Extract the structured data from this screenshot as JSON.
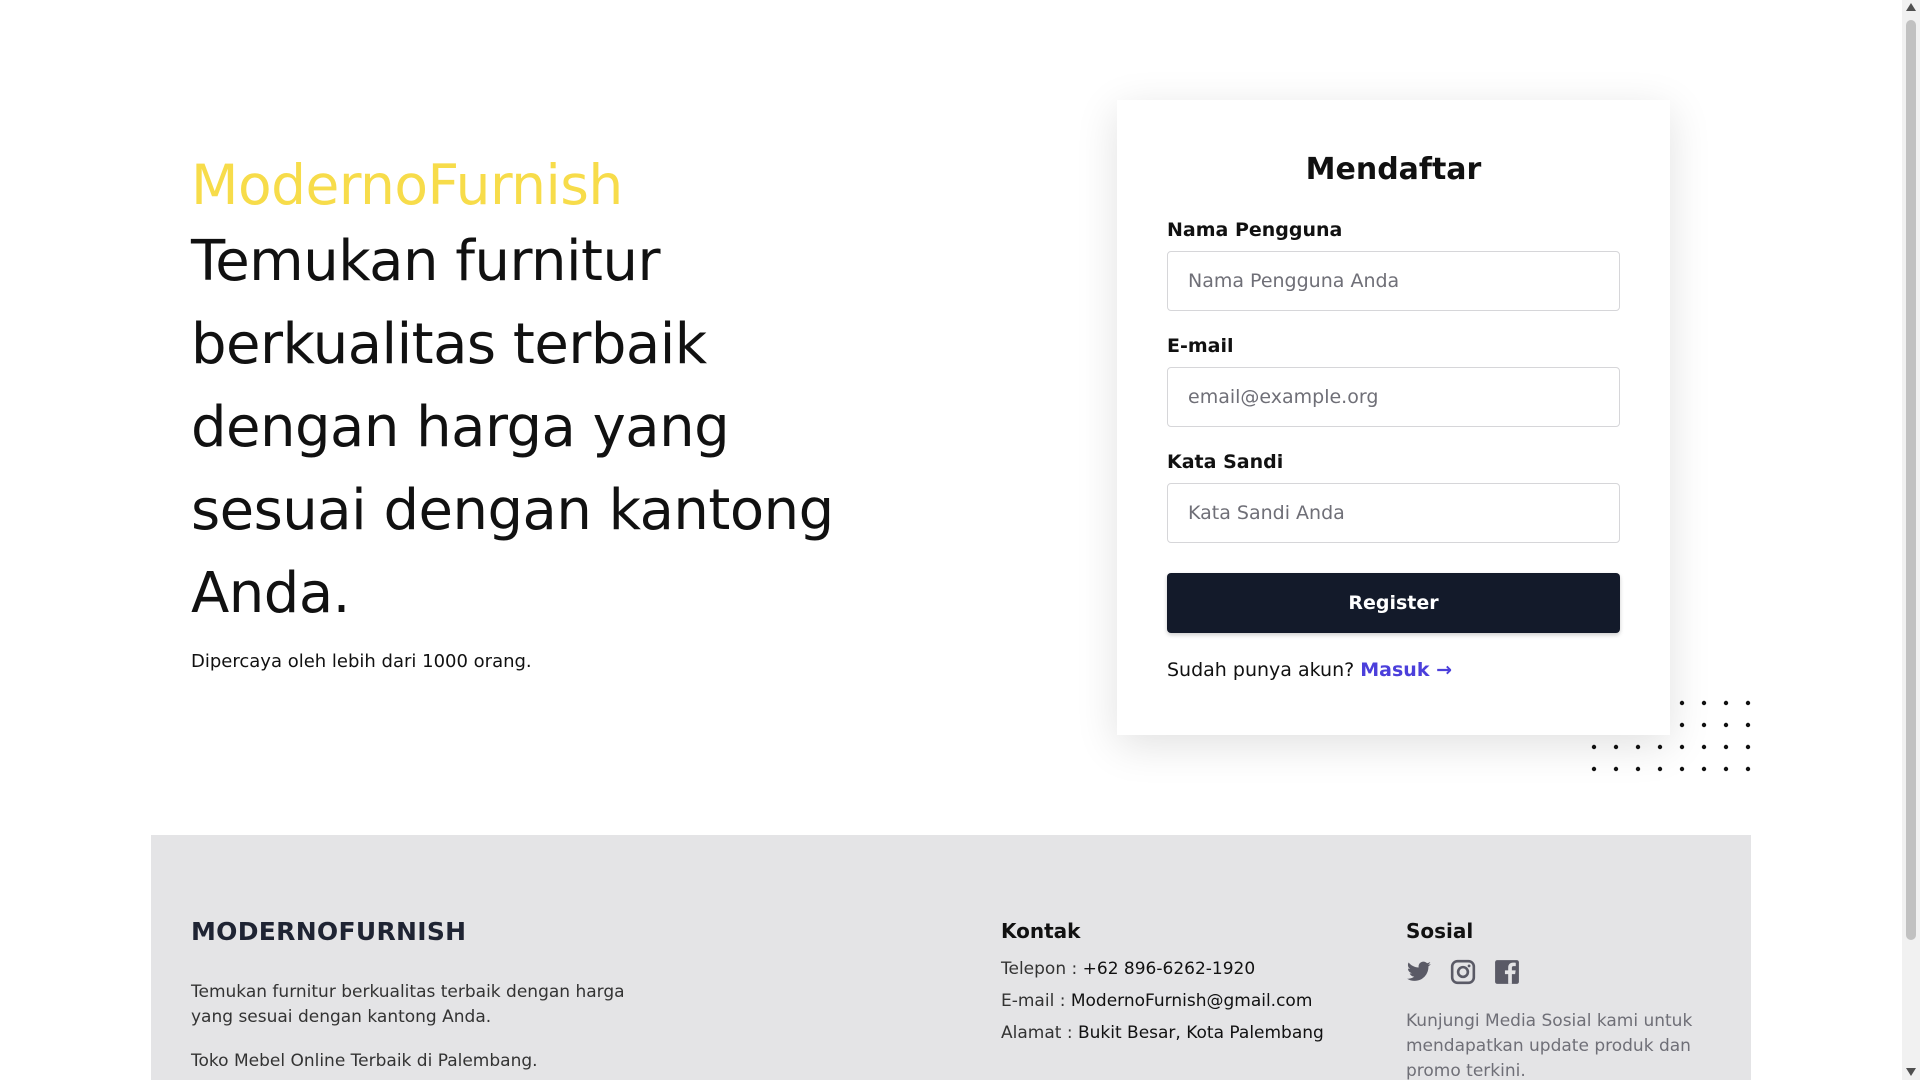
{
  "hero": {
    "brand": "ModernoFurnish",
    "tagline": "Temukan furnitur berkualitas terbaik dengan harga yang sesuai dengan kantong Anda.",
    "trust": "Dipercaya oleh lebih dari 1000 orang."
  },
  "form": {
    "title": "Mendaftar",
    "username_label": "Nama Pengguna",
    "username_placeholder": "Nama Pengguna Anda",
    "email_label": "E-mail",
    "email_placeholder": "email@example.org",
    "password_label": "Kata Sandi",
    "password_placeholder": "Kata Sandi Anda",
    "submit_label": "Register",
    "login_prompt": "Sudah punya akun?",
    "login_link": "Masuk →"
  },
  "footer": {
    "brand": "MODERNOFURNISH",
    "description": "Temukan furnitur berkualitas terbaik dengan harga yang sesuai dengan kantong Anda.",
    "subtitle": "Toko Mebel Online Terbaik di Palembang.",
    "contact": {
      "heading": "Kontak",
      "phone_label": "Telepon : ",
      "phone_value": "+62 896-6262-1920",
      "email_label": "E-mail : ",
      "email_value": "ModernoFurnish@gmail.com",
      "address_label": "Alamat : ",
      "address_value": "Bukit Besar, Kota Palembang"
    },
    "social": {
      "heading": "Sosial",
      "icons": [
        "twitter-icon",
        "instagram-icon",
        "facebook-icon"
      ],
      "description": "Kunjungi Media Sosial kami untuk mendapatkan update produk dan promo terkini."
    }
  },
  "colors": {
    "brand": "#f7dc4a",
    "button": "#131a2a",
    "link": "#4b3fdb",
    "footer_bg": "#e4e4e6"
  }
}
